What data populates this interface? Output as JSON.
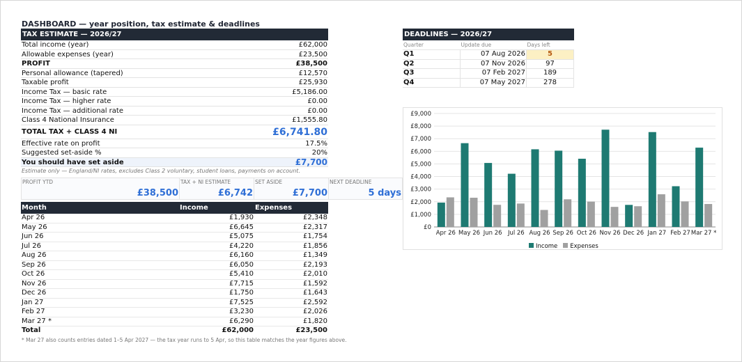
{
  "title": "DASHBOARD — year position, tax estimate & deadlines",
  "tax": {
    "header": "TAX ESTIMATE — 2026/27",
    "rows": [
      {
        "label": "Total income (year)",
        "value": "£62,000"
      },
      {
        "label": "Allowable expenses (year)",
        "value": "£23,500"
      },
      {
        "label": "PROFIT",
        "value": "£38,500"
      },
      {
        "label": "Personal allowance (tapered)",
        "value": "£12,570"
      },
      {
        "label": "Taxable profit",
        "value": "£25,930"
      },
      {
        "label": "Income Tax — basic rate",
        "value": "£5,186.00"
      },
      {
        "label": "Income Tax — higher rate",
        "value": "£0.00"
      },
      {
        "label": "Income Tax — additional rate",
        "value": "£0.00"
      },
      {
        "label": "Class 4 National Insurance",
        "value": "£1,555.80"
      }
    ],
    "total_label": "TOTAL TAX + CLASS 4 NI",
    "total_value": "£6,741.80",
    "effective_label": "Effective rate on profit",
    "effective_value": "17.5%",
    "suggested_label": "Suggested set-aside %",
    "suggested_value": "20%",
    "setaside_label": "You should have set aside",
    "setaside_value": "£7,700",
    "note": "Estimate only — England/NI rates, excludes Class 2 voluntary, student loans, payments on account."
  },
  "kpis": [
    {
      "label": "PROFIT YTD",
      "value": "£38,500"
    },
    {
      "label": "TAX + NI ESTIMATE",
      "value": "£6,742"
    },
    {
      "label": "SET ASIDE",
      "value": "£7,700"
    },
    {
      "label": "NEXT DEADLINE",
      "value": "5 days"
    }
  ],
  "months": {
    "headers": [
      "Month",
      "Income",
      "Expenses"
    ],
    "rows": [
      [
        "Apr 26",
        "£1,930",
        "£2,348"
      ],
      [
        "May 26",
        "£6,645",
        "£2,317"
      ],
      [
        "Jun 26",
        "£5,075",
        "£1,754"
      ],
      [
        "Jul 26",
        "£4,220",
        "£1,856"
      ],
      [
        "Aug 26",
        "£6,160",
        "£1,349"
      ],
      [
        "Sep 26",
        "£6,050",
        "£2,193"
      ],
      [
        "Oct 26",
        "£5,410",
        "£2,010"
      ],
      [
        "Nov 26",
        "£7,715",
        "£1,592"
      ],
      [
        "Dec 26",
        "£1,750",
        "£1,643"
      ],
      [
        "Jan 27",
        "£7,525",
        "£2,592"
      ],
      [
        "Feb 27",
        "£3,230",
        "£2,026"
      ],
      [
        "Mar 27 *",
        "£6,290",
        "£1,820"
      ]
    ],
    "total": [
      "Total",
      "£62,000",
      "£23,500"
    ],
    "footnote": "* Mar 27 also counts entries dated 1–5 Apr 2027 — the tax year runs to 5 Apr, so this table matches the year figures above."
  },
  "deadlines": {
    "header": "DEADLINES — 2026/27",
    "columns": [
      "Quarter",
      "Update due",
      "Days left"
    ],
    "rows": [
      [
        "Q1",
        "07 Aug 2026",
        "5"
      ],
      [
        "Q2",
        "07 Nov 2026",
        "97"
      ],
      [
        "Q3",
        "07 Feb 2027",
        "189"
      ],
      [
        "Q4",
        "07 May 2027",
        "278"
      ]
    ],
    "highlight_color": "#fcf0c4"
  },
  "chart_data": {
    "type": "bar",
    "categories": [
      "Apr 26",
      "May 26",
      "Jun 26",
      "Jul 26",
      "Aug 26",
      "Sep 26",
      "Oct 26",
      "Nov 26",
      "Dec 26",
      "Jan 27",
      "Feb 27",
      "Mar 27 *"
    ],
    "series": [
      {
        "name": "Income",
        "color": "#1e7a72",
        "values": [
          1930,
          6645,
          5075,
          4220,
          6160,
          6050,
          5410,
          7715,
          1750,
          7525,
          3230,
          6290
        ]
      },
      {
        "name": "Expenses",
        "color": "#a0a0a0",
        "values": [
          2348,
          2317,
          1754,
          1856,
          1349,
          2193,
          2010,
          1592,
          1643,
          2592,
          2026,
          1820
        ]
      }
    ],
    "yticks": [
      "£0",
      "£1,000",
      "£2,000",
      "£3,000",
      "£4,000",
      "£5,000",
      "£6,000",
      "£7,000",
      "£8,000",
      "£9,000"
    ],
    "ylim": [
      0,
      9000
    ],
    "grid": true,
    "legend": "bottom"
  }
}
